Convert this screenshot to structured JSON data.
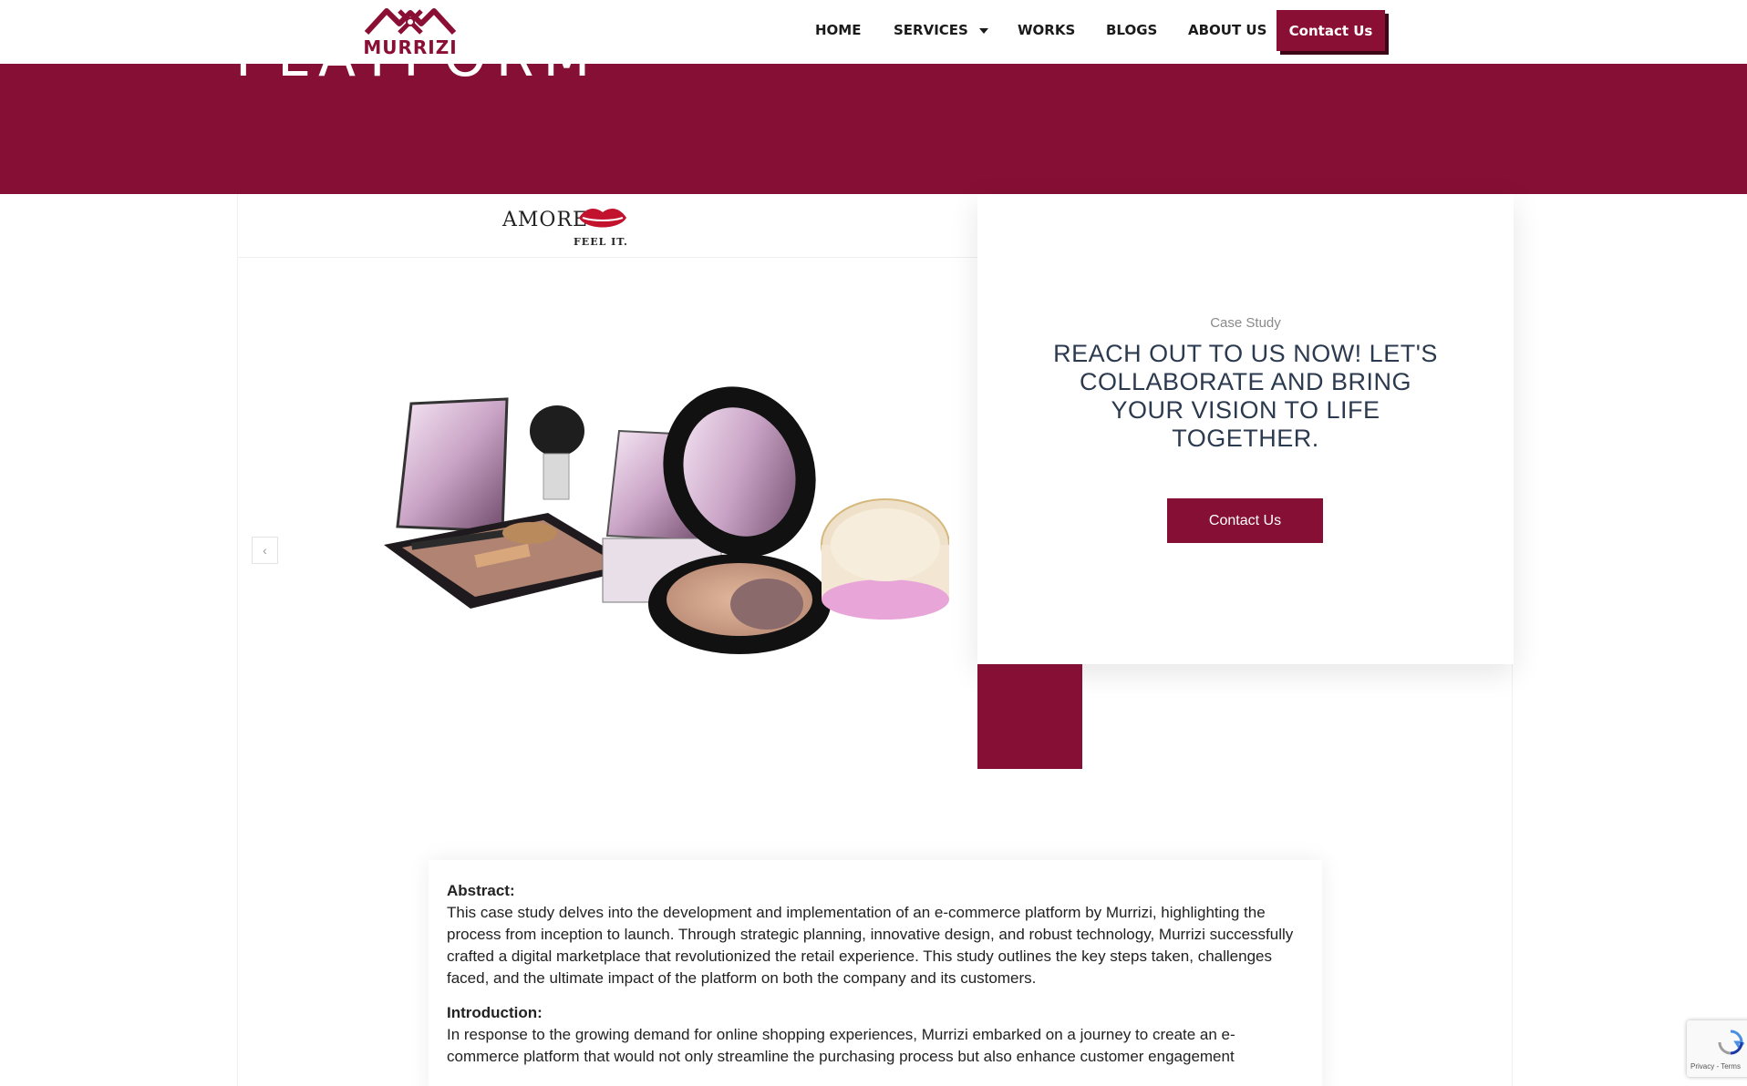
{
  "header": {
    "logo_text": "MURRIZI",
    "nav": {
      "home": "HOME",
      "services": "SERVICES",
      "works": "WORKS",
      "blogs": "BLOGS",
      "about": "ABOUT US",
      "contact": "Contact Us"
    }
  },
  "hero": {
    "title_fragment": "PLATFORM"
  },
  "slider": {
    "brand_name": "AMORE",
    "brand_tagline": "FEEL IT.",
    "prev_icon": "chevron-left-icon"
  },
  "card": {
    "label": "Case Study",
    "title": "REACH OUT TO US NOW! LET'S COLLABORATE AND BRING YOUR VISION TO LIFE TOGETHER.",
    "button": "Contact Us"
  },
  "article": {
    "abstract_heading": "Abstract:",
    "abstract_body": "This case study delves into the development and implementation of an e-commerce platform by Murrizi, highlighting the process from inception to launch. Through strategic planning, innovative design, and robust technology, Murrizi successfully crafted a digital marketplace that revolutionized the retail experience. This study outlines the key steps taken, challenges faced, and the ultimate impact of the platform on both the company and its customers.",
    "intro_heading": "Introduction:",
    "intro_body": "In response to the growing demand for online shopping experiences, Murrizi embarked on a journey to create an e-commerce platform that would not only streamline the purchasing process but also enhance customer engagement"
  },
  "recaptcha": {
    "text": "Privacy - Terms"
  },
  "colors": {
    "brand": "#860f35",
    "brand_dark": "#3c0616",
    "heading": "#2c3a4f"
  }
}
